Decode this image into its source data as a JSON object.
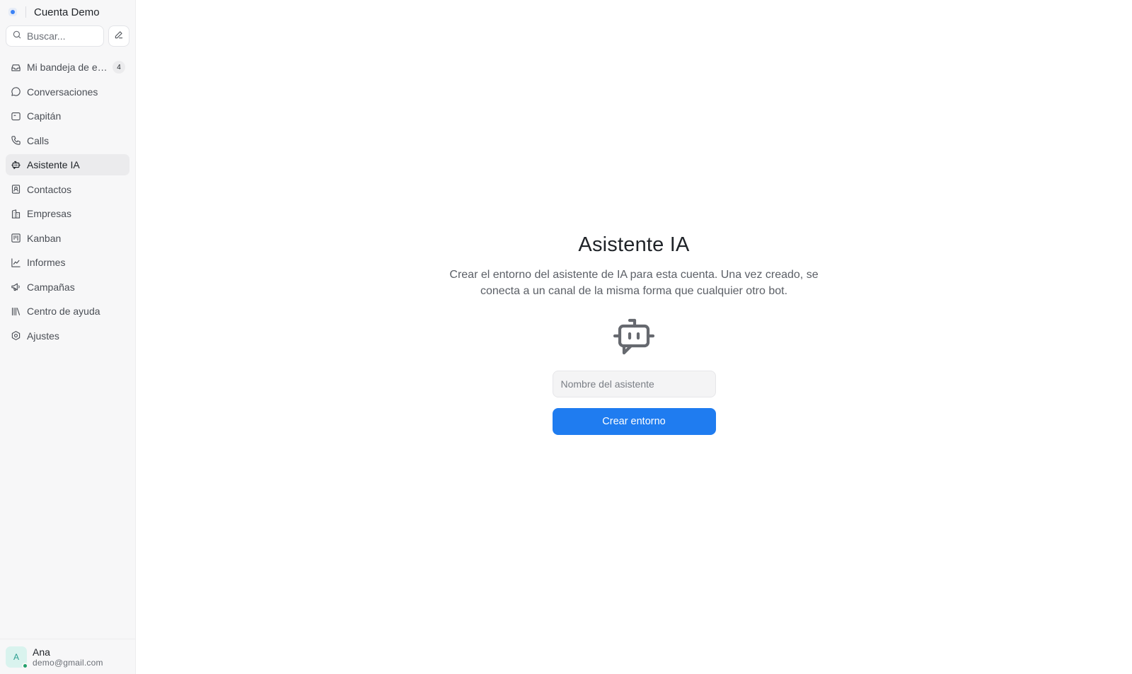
{
  "account": {
    "name": "Cuenta Demo"
  },
  "search": {
    "placeholder": "Buscar..."
  },
  "sidebar": {
    "items": [
      {
        "label": "Mi bandeja de entrada",
        "icon": "inbox-icon",
        "badge": "4"
      },
      {
        "label": "Conversaciones",
        "icon": "chat-bubble-icon"
      },
      {
        "label": "Capitán",
        "icon": "captain-icon"
      },
      {
        "label": "Calls",
        "icon": "phone-icon"
      },
      {
        "label": "Asistente IA",
        "icon": "bot-icon",
        "active": true
      },
      {
        "label": "Contactos",
        "icon": "contact-card-icon"
      },
      {
        "label": "Empresas",
        "icon": "building-icon"
      },
      {
        "label": "Kanban",
        "icon": "kanban-icon"
      },
      {
        "label": "Informes",
        "icon": "chart-line-icon"
      },
      {
        "label": "Campañas",
        "icon": "megaphone-icon"
      },
      {
        "label": "Centro de ayuda",
        "icon": "library-icon"
      },
      {
        "label": "Ajustes",
        "icon": "settings-icon"
      }
    ]
  },
  "user": {
    "initial": "A",
    "name": "Ana",
    "email": "demo@gmail.com",
    "status": "online"
  },
  "main": {
    "title": "Asistente IA",
    "description": "Crear el entorno del asistente de IA para esta cuenta. Una vez creado, se conecta a un canal de la misma forma que cualquier otro bot.",
    "input_placeholder": "Nombre del asistente",
    "button_label": "Crear entorno"
  },
  "colors": {
    "primary": "#1f7cf0",
    "sidebar_bg": "#f7f7f8",
    "active_item_bg": "#ebebed",
    "online": "#22a06b"
  }
}
